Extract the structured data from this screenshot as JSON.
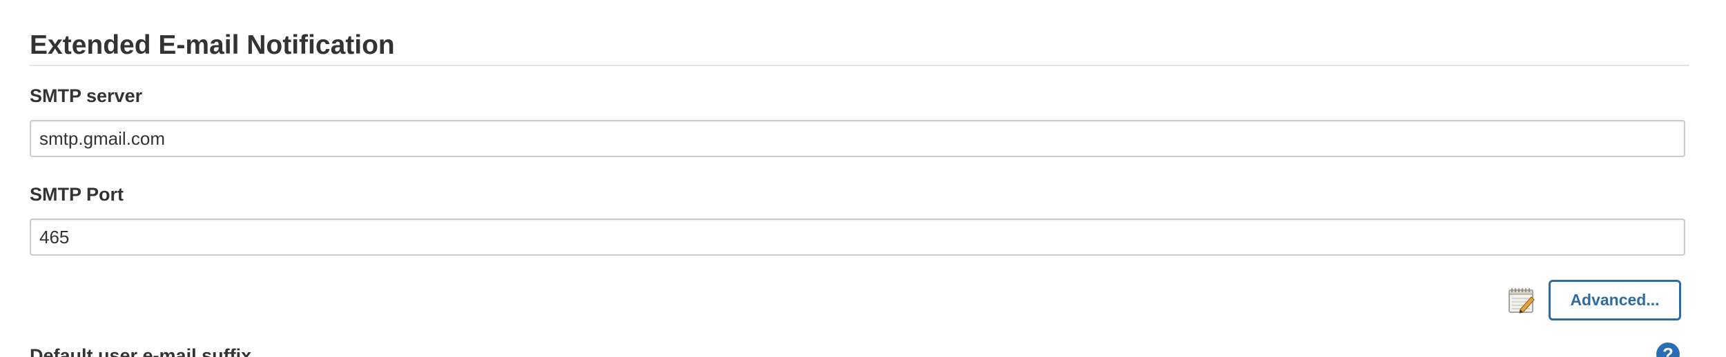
{
  "section": {
    "title": "Extended E-mail Notification"
  },
  "fields": {
    "smtp_server": {
      "label": "SMTP server",
      "value": "smtp.gmail.com"
    },
    "smtp_port": {
      "label": "SMTP Port",
      "value": "465"
    },
    "default_suffix": {
      "label": "Default user e-mail suffix"
    }
  },
  "actions": {
    "advanced_label": "Advanced...",
    "notepad_icon": "notepad-pencil-icon"
  },
  "help": {
    "glyph": "?",
    "icon": "help-icon"
  },
  "colors": {
    "accent": "#2d6ca2",
    "text": "#333333",
    "border": "#cccccc",
    "help_bg": "#2a6db3"
  }
}
